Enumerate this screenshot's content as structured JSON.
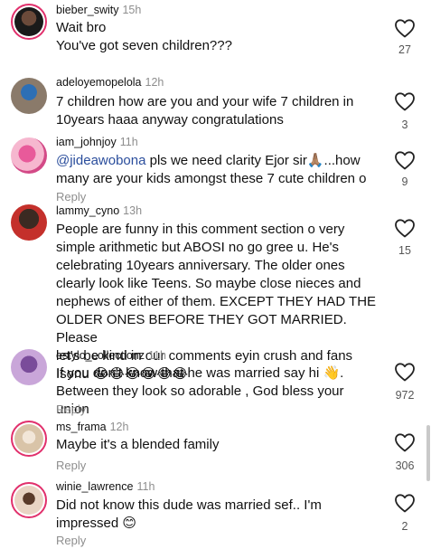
{
  "comments": [
    {
      "user": "bieber_swity",
      "time": "15h",
      "lines": [
        "Wait bro",
        "You've got seven children???"
      ],
      "likes": "27",
      "reply": ""
    },
    {
      "user": "adeloyemopelola",
      "time": "12h",
      "lines": [
        "7 children how are you and your wife 7 children in",
        "10years haaa anyway congratulations"
      ],
      "likes": "3",
      "reply": ""
    },
    {
      "user": "iam_johnjoy",
      "time": "11h",
      "mention": "@jideawobona",
      "lines": [
        " pls we need clarity Ejor sir🙏🏽...how",
        "many are your kids amongst these 7 cute children o"
      ],
      "likes": "9",
      "reply": "Reply"
    },
    {
      "user": "lammy_cyno",
      "time": "13h",
      "lines": [
        "People are funny in this comment section o very",
        "simple arithmetic but ABOSI no go gree u. He's",
        "celebrating 10years anniversary. The older ones",
        "clearly look like Teens. So maybe close nieces and",
        "nephews of either of them. EXCEPT THEY HAD THE",
        "OLDER ONES BEFORE THEY GOT MARRIED. Please",
        "let's be kind in our comments eyin crush and fans",
        "Isonu 😂😂😂😂😂😂"
      ],
      "likes": "15",
      "reply": ""
    },
    {
      "user": "estylo_collectionz",
      "time": "11h",
      "lines": [
        "If you don't know that he was married say hi 👋.",
        "Between they look so adorable , God bless your union"
      ],
      "likes": "972",
      "reply": "Reply"
    },
    {
      "user": "ms_frama",
      "time": "12h",
      "lines": [
        "Maybe it's a blended family"
      ],
      "likes": "306",
      "reply": "Reply"
    },
    {
      "user": "winie_lawrence",
      "time": "11h",
      "lines": [
        "Did not know this dude was married sef.. I'm",
        "impressed 😊"
      ],
      "likes": "2",
      "reply": "Reply"
    }
  ]
}
